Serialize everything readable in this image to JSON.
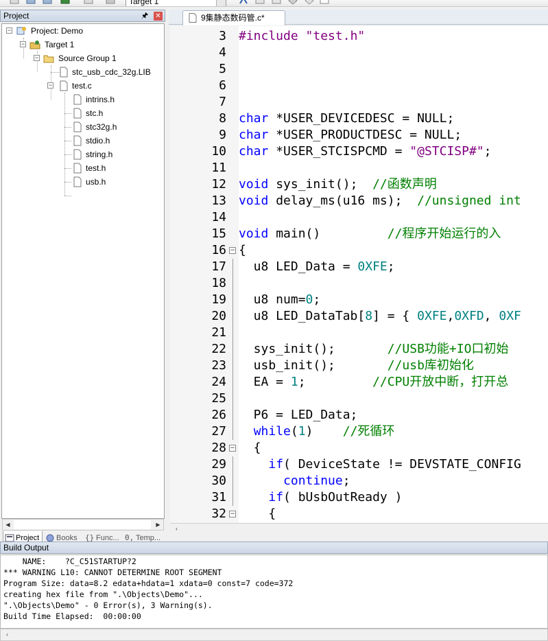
{
  "toolbar": {
    "target_combo": "Target 1"
  },
  "project_panel": {
    "title": "Project",
    "tree": [
      {
        "label": "Project: Demo",
        "icon": "project-icon"
      },
      {
        "label": "Target 1",
        "icon": "target-icon"
      },
      {
        "label": "Source Group 1",
        "icon": "folder-icon"
      },
      {
        "label": "stc_usb_cdc_32g.LIB",
        "icon": "file-icon"
      },
      {
        "label": "test.c",
        "icon": "file-icon"
      },
      {
        "label": "intrins.h",
        "icon": "file-icon"
      },
      {
        "label": "stc.h",
        "icon": "file-icon"
      },
      {
        "label": "stc32g.h",
        "icon": "file-icon"
      },
      {
        "label": "stdio.h",
        "icon": "file-icon"
      },
      {
        "label": "string.h",
        "icon": "file-icon"
      },
      {
        "label": "test.h",
        "icon": "file-icon"
      },
      {
        "label": "usb.h",
        "icon": "file-icon"
      }
    ],
    "tabs": [
      {
        "label": "Project",
        "icon": "project-tab-icon"
      },
      {
        "label": "Books",
        "icon": "books-icon"
      },
      {
        "label": "Func...",
        "icon": "functions-icon"
      },
      {
        "label": "Temp...",
        "icon": "templates-icon"
      }
    ]
  },
  "editor": {
    "tab_label": "9集静态数码管.c*",
    "lines": [
      {
        "n": "3",
        "fold": "",
        "tokens": [
          [
            "pp",
            "#include "
          ],
          [
            "str",
            "\"test.h\""
          ]
        ]
      },
      {
        "n": "4",
        "fold": "",
        "tokens": []
      },
      {
        "n": "5",
        "fold": "",
        "tokens": []
      },
      {
        "n": "6",
        "fold": "",
        "tokens": []
      },
      {
        "n": "7",
        "fold": "",
        "tokens": []
      },
      {
        "n": "8",
        "fold": "",
        "tokens": [
          [
            "kw",
            "char"
          ],
          [
            "",
            " *USER_DEVICEDESC = NULL;"
          ]
        ]
      },
      {
        "n": "9",
        "fold": "",
        "tokens": [
          [
            "kw",
            "char"
          ],
          [
            "",
            " *USER_PRODUCTDESC = NULL;"
          ]
        ]
      },
      {
        "n": "10",
        "fold": "",
        "tokens": [
          [
            "kw",
            "char"
          ],
          [
            "",
            " *USER_STCISPCMD = "
          ],
          [
            "str",
            "\"@STCISP#\""
          ],
          [
            "",
            ";"
          ]
        ]
      },
      {
        "n": "11",
        "fold": "",
        "tokens": []
      },
      {
        "n": "12",
        "fold": "",
        "tokens": [
          [
            "kw",
            "void"
          ],
          [
            "",
            " sys_init();  "
          ],
          [
            "cmt",
            "//函数声明"
          ]
        ]
      },
      {
        "n": "13",
        "fold": "",
        "tokens": [
          [
            "kw",
            "void"
          ],
          [
            "",
            " delay_ms(u16 ms);  "
          ],
          [
            "cmt",
            "//unsigned int"
          ]
        ]
      },
      {
        "n": "14",
        "fold": "",
        "tokens": []
      },
      {
        "n": "15",
        "fold": "",
        "tokens": [
          [
            "kw",
            "void"
          ],
          [
            "",
            " main()         "
          ],
          [
            "cmt",
            "//程序开始运行的入"
          ]
        ]
      },
      {
        "n": "16",
        "fold": "open",
        "tokens": [
          [
            "",
            "{"
          ]
        ]
      },
      {
        "n": "17",
        "fold": "line",
        "tokens": [
          [
            "",
            "  u8 LED_Data = "
          ],
          [
            "num",
            "0XFE"
          ],
          [
            "",
            ";"
          ]
        ]
      },
      {
        "n": "18",
        "fold": "line",
        "tokens": []
      },
      {
        "n": "19",
        "fold": "line",
        "tokens": [
          [
            "",
            "  u8 num="
          ],
          [
            "num",
            "0"
          ],
          [
            "",
            ";"
          ]
        ]
      },
      {
        "n": "20",
        "fold": "line",
        "tokens": [
          [
            "",
            "  u8 LED_DataTab["
          ],
          [
            "num",
            "8"
          ],
          [
            "",
            "] = { "
          ],
          [
            "num",
            "0XFE"
          ],
          [
            "",
            ","
          ],
          [
            "num",
            "0XFD"
          ],
          [
            "",
            ", "
          ],
          [
            "num",
            "0XF"
          ]
        ]
      },
      {
        "n": "21",
        "fold": "line",
        "tokens": []
      },
      {
        "n": "22",
        "fold": "line",
        "tokens": [
          [
            "",
            "  sys_init();       "
          ],
          [
            "cmt",
            "//USB功能+IO口初始"
          ]
        ]
      },
      {
        "n": "23",
        "fold": "line",
        "tokens": [
          [
            "",
            "  usb_init();       "
          ],
          [
            "cmt",
            "//usb库初始化"
          ]
        ]
      },
      {
        "n": "24",
        "fold": "line",
        "tokens": [
          [
            "",
            "  EA = "
          ],
          [
            "num",
            "1"
          ],
          [
            "",
            ";         "
          ],
          [
            "cmt",
            "//CPU开放中断，打开总"
          ]
        ]
      },
      {
        "n": "25",
        "fold": "line",
        "tokens": []
      },
      {
        "n": "26",
        "fold": "line",
        "tokens": [
          [
            "",
            "  P6 = LED_Data;"
          ]
        ]
      },
      {
        "n": "27",
        "fold": "line",
        "tokens": [
          [
            "",
            "  "
          ],
          [
            "kw",
            "while"
          ],
          [
            "",
            "("
          ],
          [
            "num",
            "1"
          ],
          [
            "",
            ")    "
          ],
          [
            "cmt",
            "//死循环"
          ]
        ]
      },
      {
        "n": "28",
        "fold": "open",
        "tokens": [
          [
            "",
            "  {"
          ]
        ]
      },
      {
        "n": "29",
        "fold": "line",
        "tokens": [
          [
            "",
            "    "
          ],
          [
            "kw",
            "if"
          ],
          [
            "",
            "( DeviceState != DEVSTATE_CONFIG"
          ]
        ]
      },
      {
        "n": "30",
        "fold": "line",
        "tokens": [
          [
            "",
            "      "
          ],
          [
            "kw",
            "continue"
          ],
          [
            "",
            ";"
          ]
        ]
      },
      {
        "n": "31",
        "fold": "line",
        "tokens": [
          [
            "",
            "    "
          ],
          [
            "kw",
            "if"
          ],
          [
            "",
            "( bUsbOutReady )"
          ]
        ]
      },
      {
        "n": "32",
        "fold": "open",
        "tokens": [
          [
            "",
            "    {"
          ]
        ]
      }
    ]
  },
  "build_output": {
    "title": "Build Output",
    "lines": [
      "    NAME:    ?C_C51STARTUP?2",
      "*** WARNING L10: CANNOT DETERMINE ROOT SEGMENT",
      "Program Size: data=8.2 edata+hdata=1 xdata=0 const=7 code=372",
      "creating hex file from \".\\Objects\\Demo\"...",
      "\".\\Objects\\Demo\" - 0 Error(s), 3 Warning(s).",
      "Build Time Elapsed:  00:00:00"
    ]
  }
}
